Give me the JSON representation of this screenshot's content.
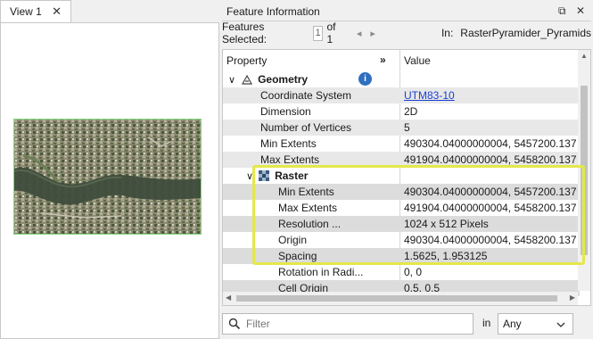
{
  "view": {
    "tab_label": "View 1",
    "close_glyph": "✕"
  },
  "panel": {
    "title": "Feature Information",
    "float_glyph": "⧉",
    "close_glyph": "✕",
    "features_selected_label": "Features Selected:",
    "selected_index": "1",
    "of_label": "of 1",
    "prev_glyph": "◂",
    "next_glyph": "▸",
    "in_label": "In:",
    "in_value": "RasterPyramider_Pyramids"
  },
  "grid": {
    "col_property": "Property",
    "col_expand": "»",
    "col_value": "Value",
    "geometry": {
      "label": "Geometry",
      "expand_glyph": "∨",
      "info_glyph": "i"
    },
    "geometry_rows": [
      {
        "prop": "Coordinate System",
        "value": "UTM83-10",
        "link": true
      },
      {
        "prop": "Dimension",
        "value": "2D"
      },
      {
        "prop": "Number of Vertices",
        "value": "5"
      },
      {
        "prop": "Min Extents",
        "value": "490304.04000000004, 5457200.137"
      },
      {
        "prop": "Max Extents",
        "value": "491904.04000000004, 5458200.137"
      }
    ],
    "raster": {
      "label": "Raster",
      "expand_glyph": "∨"
    },
    "raster_rows": [
      {
        "prop": "Min Extents",
        "value": "490304.04000000004, 5457200.137"
      },
      {
        "prop": "Max Extents",
        "value": "491904.04000000004, 5458200.137"
      },
      {
        "prop": "Resolution ...",
        "value": "1024 x 512 Pixels"
      },
      {
        "prop": "Origin",
        "value": "490304.04000000004, 5458200.137"
      },
      {
        "prop": "Spacing",
        "value": "1.5625, 1.953125"
      },
      {
        "prop": "Rotation in Radi...",
        "value": "0, 0"
      },
      {
        "prop": "Cell Origin",
        "value": "0.5, 0.5"
      }
    ]
  },
  "filter": {
    "placeholder": "Filter",
    "search_glyph": "⚲"
  },
  "in_filter": {
    "label": "in",
    "value": "Any",
    "caret": "⌄"
  },
  "colors": {
    "highlight": "#e3e84a",
    "link": "#1a3fd1",
    "info": "#2f6fc0"
  }
}
